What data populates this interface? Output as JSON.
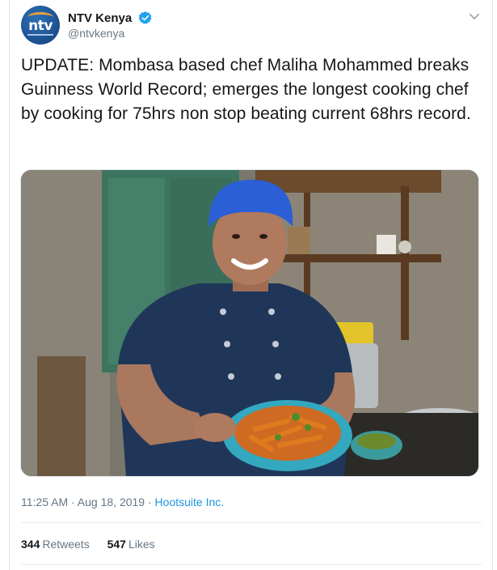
{
  "account": {
    "display_name": "NTV Kenya",
    "handle": "@ntvkenya",
    "avatar_logo_text": "ntv",
    "verified": true
  },
  "tweet": {
    "text": "UPDATE: Mombasa based chef Maliha Mohammed breaks Guinness World Record; emerges the longest cooking chef by cooking for 75hrs non stop beating current 68hrs record.",
    "time": "11:25 AM",
    "separator1": " · ",
    "date": "Aug 18, 2019",
    "separator2": " · ",
    "source": "Hootsuite Inc."
  },
  "stats": {
    "retweets_count": "344",
    "retweets_label": "Retweets",
    "likes_count": "547",
    "likes_label": "Likes"
  },
  "colors": {
    "link": "#1b95e0",
    "verified": "#1da1f2",
    "muted": "#657786",
    "text": "#14171a",
    "border": "#e1e8ed"
  },
  "icons": {
    "verified": "verified-badge-icon",
    "caret": "chevron-down-icon"
  }
}
